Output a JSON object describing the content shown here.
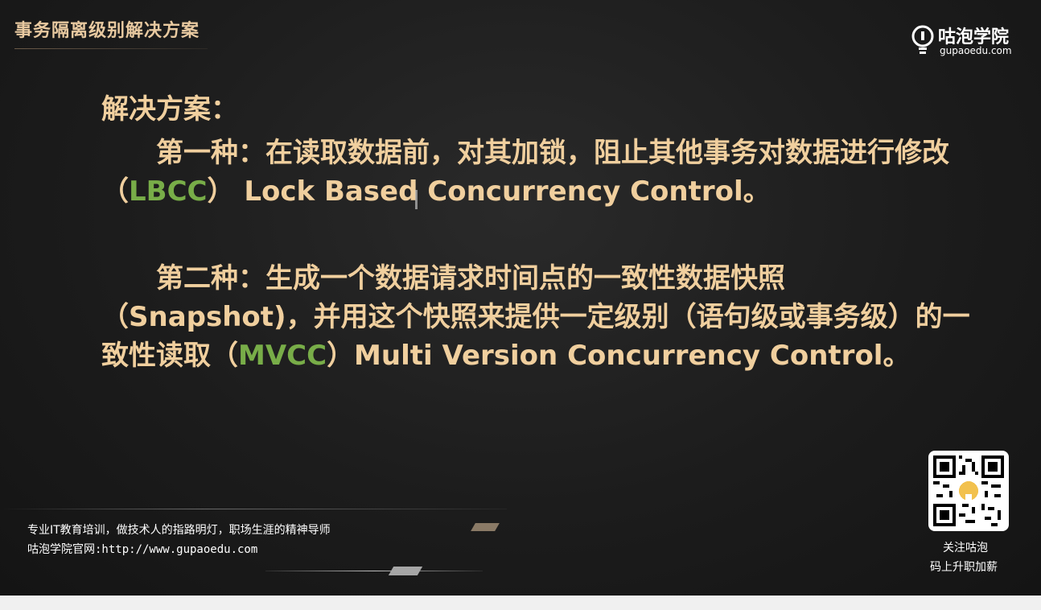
{
  "header": {
    "title": "事务隔离级别解决方案"
  },
  "logo": {
    "name": "咕泡学院",
    "url": "gupaoedu.com",
    "icon": "lightbulb-icon"
  },
  "content": {
    "heading": "解决方案：",
    "solution1": {
      "prefix": "第一种：在读取数据前，对其加锁，阻止其他事务对数据进行修改（",
      "acronym": "LBCC",
      "suffix": "） Lock Based Concurrency Control。"
    },
    "solution2": {
      "prefix": "第二种：生成一个数据请求时间点的一致性数据快照（Snapshot)，并用这个快照来提供一定级别（语句级或事务级）的一致性读取（",
      "acronym": "MVCC",
      "suffix": "）Multi Version Concurrency Control。"
    }
  },
  "footer": {
    "tagline": "专业IT教育培训，做技术人的指路明灯，职场生涯的精神导师",
    "website": "咕泡学院官网:http://www.gupaoedu.com"
  },
  "qr": {
    "caption_line1": "关注咕泡",
    "caption_line2": "码上升职加薪"
  },
  "colors": {
    "text_gold": "#f0cf9e",
    "accent_green": "#78ad48",
    "background": "#1c1c1c"
  }
}
